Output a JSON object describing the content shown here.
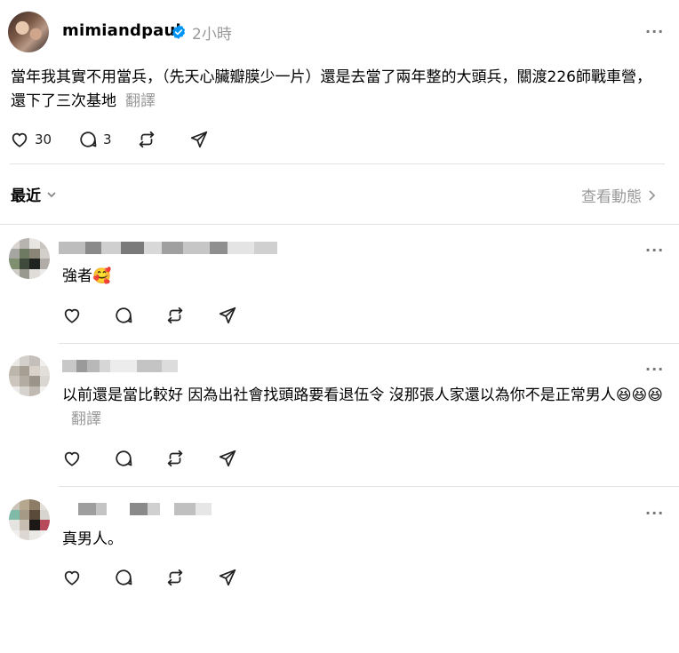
{
  "post": {
    "username": "mimiandpaul",
    "time": "2小時",
    "more": "···",
    "text": "當年我其實不用當兵，（先天心臟瓣膜少一片）還是去當了兩年整的大頭兵，關渡226師戰車營，還下了三次基地",
    "translate": "翻譯",
    "likes": "30",
    "comments": "3"
  },
  "filter": {
    "sort_label": "最近",
    "activity_label": "查看動態"
  },
  "replies": [
    {
      "text": "強者",
      "emoji": "🥰",
      "more": "···"
    },
    {
      "text": "以前還是當比較好 因為出社會找頭路要看退伍令 沒那張人家還以為你不是正常男人",
      "emoji": "😆😆😆",
      "translate": "翻譯",
      "more": "···"
    },
    {
      "text": "真男人。",
      "more": "···"
    }
  ],
  "colors": {
    "verified": "#0095f6",
    "muted": "#999999",
    "divider": "#e2e2e2"
  }
}
